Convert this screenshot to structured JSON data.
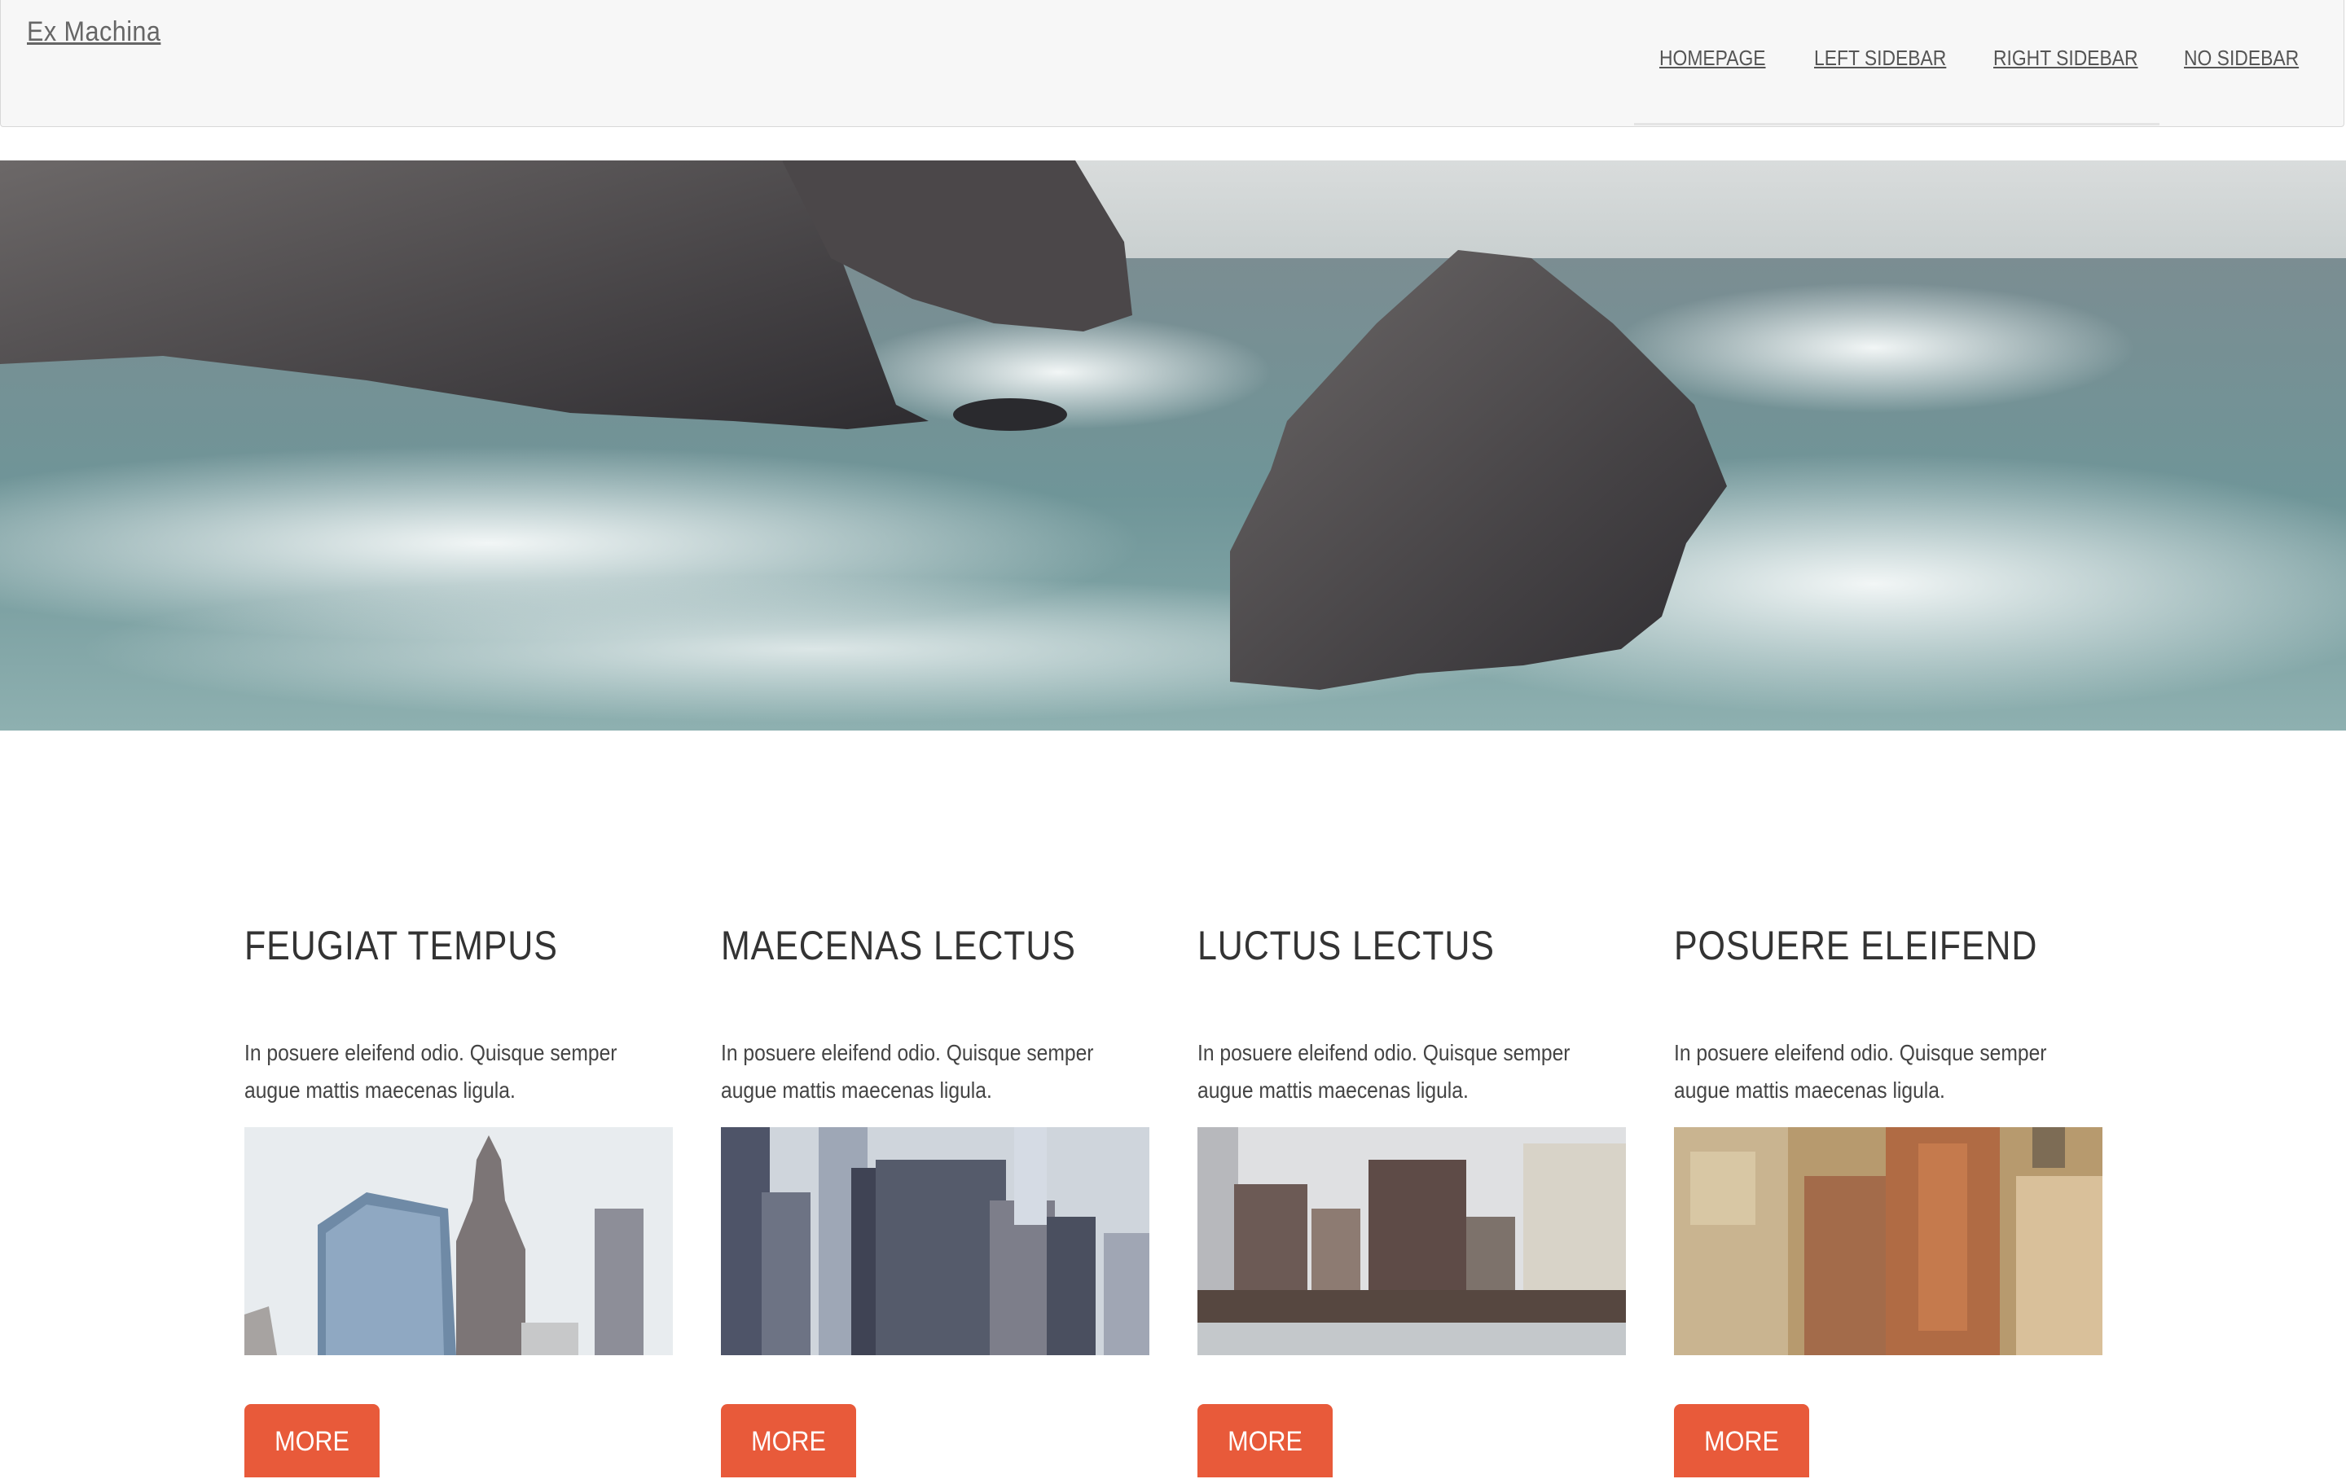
{
  "header": {
    "brand": "Ex Machina",
    "nav": [
      {
        "label": "HOMEPAGE"
      },
      {
        "label": "LEFT SIDEBAR"
      },
      {
        "label": "RIGHT SIDEBAR"
      },
      {
        "label": "NO SIDEBAR"
      }
    ]
  },
  "hero": {
    "image": "ocean-rocks-waves"
  },
  "cards": [
    {
      "title": "FEUGIAT TEMPUS",
      "text": "In posuere eleifend odio. Quisque semper augue mattis maecenas ligula.",
      "image": "skyscrapers-blue-glass",
      "button": "MORE"
    },
    {
      "title": "MAECENAS LECTUS",
      "text": "In posuere eleifend odio. Quisque semper augue mattis maecenas ligula.",
      "image": "downtown-towers",
      "button": "MORE"
    },
    {
      "title": "LUCTUS LECTUS",
      "text": "In posuere eleifend odio. Quisque semper augue mattis maecenas ligula.",
      "image": "waterfront-buildings",
      "button": "MORE"
    },
    {
      "title": "POSUERE ELEIFEND",
      "text": "In posuere eleifend odio. Quisque semper augue mattis maecenas ligula.",
      "image": "aerial-city-rooftops",
      "button": "MORE"
    }
  ],
  "colors": {
    "accent": "#e85a3a",
    "header_bg": "#f7f7f7"
  }
}
